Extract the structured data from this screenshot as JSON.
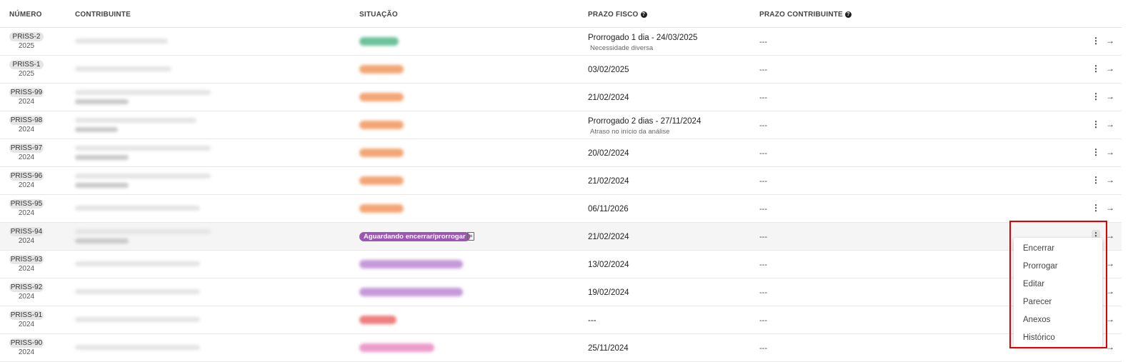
{
  "headers": {
    "numero": "NÚMERO",
    "contribuinte": "CONTRIBUINTE",
    "situacao": "SITUAÇÃO",
    "prazo_fisco": "PRAZO FISCO",
    "prazo_contribuinte": "PRAZO CONTRIBUINTE",
    "help_icon": "?"
  },
  "icons": {
    "kebab": "⋮",
    "arrow": "→"
  },
  "rows": [
    {
      "id": "PRISS-2",
      "year": "2025",
      "prazo": "Prorrogado 1 dia - 24/03/2025",
      "prazo_sub": "Necessidade diversa",
      "prazo_contrib": "---",
      "status_color": "#6cc29a"
    },
    {
      "id": "PRISS-1",
      "year": "2025",
      "prazo": "03/02/2025",
      "prazo_sub": "",
      "prazo_contrib": "---",
      "status_color": "#f3a675"
    },
    {
      "id": "PRISS-99",
      "year": "2024",
      "prazo": "21/02/2024",
      "prazo_sub": "",
      "prazo_contrib": "---",
      "status_color": "#f3a675"
    },
    {
      "id": "PRISS-98",
      "year": "2024",
      "prazo": "Prorrogado 2 dias - 27/11/2024",
      "prazo_sub": "Atraso no início da análise",
      "prazo_contrib": "---",
      "status_color": "#f3a675"
    },
    {
      "id": "PRISS-97",
      "year": "2024",
      "prazo": "20/02/2024",
      "prazo_sub": "",
      "prazo_contrib": "---",
      "status_color": "#f3a675"
    },
    {
      "id": "PRISS-96",
      "year": "2024",
      "prazo": "21/02/2024",
      "prazo_sub": "",
      "prazo_contrib": "---",
      "status_color": "#f3a675"
    },
    {
      "id": "PRISS-95",
      "year": "2024",
      "prazo": "06/11/2026",
      "prazo_sub": "",
      "prazo_contrib": "---",
      "status_color": "#f3a675"
    },
    {
      "id": "PRISS-94",
      "year": "2024",
      "prazo": "21/02/2024",
      "prazo_sub": "",
      "prazo_contrib": "---",
      "status_label": "Aguardando encerrar/prorrogar",
      "status_color": "#9c55b4"
    },
    {
      "id": "PRISS-93",
      "year": "2024",
      "prazo": "13/02/2024",
      "prazo_sub": "",
      "prazo_contrib": "---",
      "status_color": "#c59ad8"
    },
    {
      "id": "PRISS-92",
      "year": "2024",
      "prazo": "19/02/2024",
      "prazo_sub": "",
      "prazo_contrib": "---",
      "status_color": "#c59ad8"
    },
    {
      "id": "PRISS-91",
      "year": "2024",
      "prazo": "---",
      "prazo_sub": "",
      "prazo_contrib": "---",
      "status_color": "#ee7f7f"
    },
    {
      "id": "PRISS-90",
      "year": "2024",
      "prazo": "25/11/2024",
      "prazo_sub": "",
      "prazo_contrib": "---",
      "status_color": "#ec9ccb"
    }
  ],
  "menu": {
    "items": [
      "Encerrar",
      "Prorrogar",
      "Editar",
      "Parecer",
      "Anexos",
      "Histórico"
    ]
  }
}
